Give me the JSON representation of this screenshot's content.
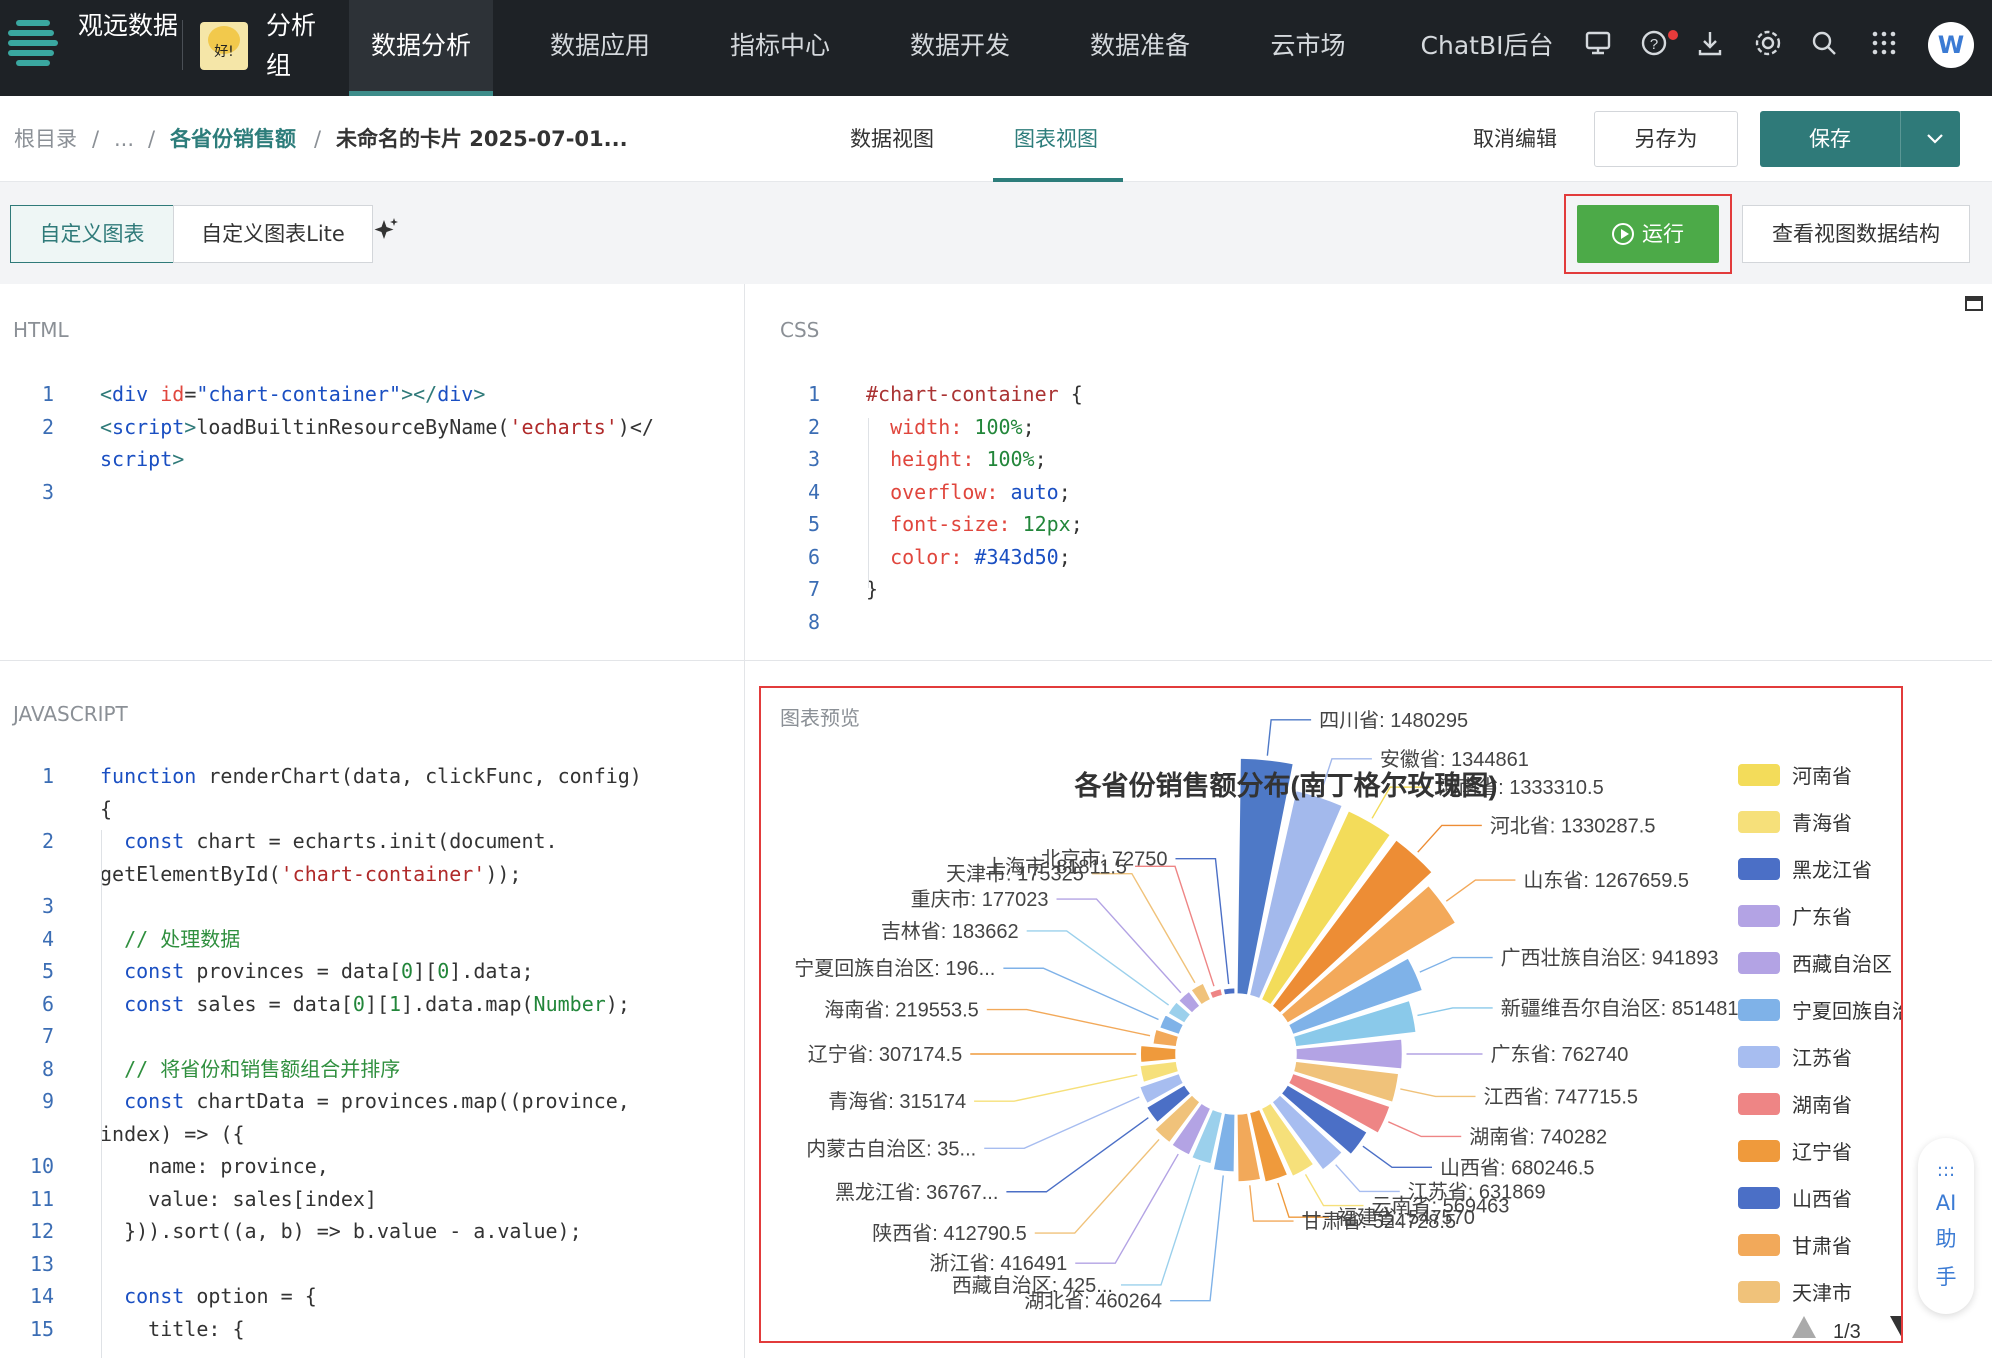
{
  "topnav": {
    "brand": "观远数据",
    "group": "分析组",
    "avatar_text": "好!",
    "items": [
      "数据分析",
      "数据应用",
      "指标中心",
      "数据开发",
      "数据准备",
      "云市场",
      "ChatBI后台"
    ],
    "user_initial": "W"
  },
  "breadcrumb": {
    "root": "根目录",
    "ellipsis": "...",
    "sep": "/",
    "folder": "各省份销售额",
    "current": "未命名的卡片 2025-07-01..."
  },
  "view_tabs": [
    "数据视图",
    "图表视图"
  ],
  "actions": {
    "cancel": "取消编辑",
    "save_as": "另存为",
    "save": "保存"
  },
  "mode_tabs": [
    "自定义图表",
    "自定义图表Lite"
  ],
  "run_label": "运行",
  "view_struct_label": "查看视图数据结构",
  "panels": {
    "html": "HTML",
    "css": "CSS",
    "js": "JAVASCRIPT",
    "preview": "图表预览"
  },
  "html_code": {
    "nums": [
      "1",
      "2",
      "",
      "3"
    ],
    "lines": [
      [
        [
          "p",
          "<"
        ],
        [
          "k",
          "div "
        ],
        [
          "a",
          "id"
        ],
        [
          "",
          "="
        ],
        [
          "v",
          "\"chart-container\""
        ],
        [
          "p",
          "></"
        ],
        [
          "k",
          "div"
        ],
        [
          "p",
          ">"
        ]
      ],
      [
        [
          "p",
          "<"
        ],
        [
          "k",
          "script"
        ],
        [
          "p",
          ">"
        ],
        [
          "",
          "loadBuiltinResourceByName("
        ],
        [
          "s",
          "'echarts'"
        ],
        [
          "",
          ")</"
        ]
      ],
      [
        [
          "k",
          "script"
        ],
        [
          "p",
          ">"
        ]
      ],
      []
    ]
  },
  "css_code": {
    "nums": [
      "1",
      "2",
      "3",
      "4",
      "5",
      "6",
      "7",
      "8"
    ],
    "lines": [
      [
        [
          "t",
          "#chart-container "
        ],
        [
          "",
          "{"
        ]
      ],
      [
        [
          "",
          "  "
        ],
        [
          "a",
          "width"
        ],
        [
          "a",
          ": "
        ],
        [
          "n",
          "100%"
        ],
        [
          "",
          ";"
        ]
      ],
      [
        [
          "",
          "  "
        ],
        [
          "a",
          "height"
        ],
        [
          "a",
          ": "
        ],
        [
          "n",
          "100%"
        ],
        [
          "",
          ";"
        ]
      ],
      [
        [
          "",
          "  "
        ],
        [
          "a",
          "overflow"
        ],
        [
          "a",
          ": "
        ],
        [
          "v",
          "auto"
        ],
        [
          "",
          ";"
        ]
      ],
      [
        [
          "",
          "  "
        ],
        [
          "a",
          "font-size"
        ],
        [
          "a",
          ": "
        ],
        [
          "n",
          "12px"
        ],
        [
          "",
          ";"
        ]
      ],
      [
        [
          "",
          "  "
        ],
        [
          "a",
          "color"
        ],
        [
          "a",
          ": "
        ],
        [
          "v",
          "#343d50"
        ],
        [
          "",
          ";"
        ]
      ],
      [
        [
          "",
          "}"
        ]
      ],
      []
    ]
  },
  "js_code": {
    "nums": [
      "1",
      "",
      "2",
      "",
      "3",
      "4",
      "5",
      "6",
      "7",
      "8",
      "9",
      "",
      "10",
      "11",
      "12",
      "13",
      "14",
      "15"
    ],
    "lines": [
      [
        [
          "k",
          "function "
        ],
        [
          "",
          "renderChart(data, clickFunc, config)"
        ]
      ],
      [
        [
          "",
          "{"
        ]
      ],
      [
        [
          "",
          "  "
        ],
        [
          "k",
          "const "
        ],
        [
          "",
          "chart = echarts.init(document."
        ]
      ],
      [
        [
          "",
          "getElementById("
        ],
        [
          "s",
          "'chart-container'"
        ],
        [
          "",
          "));"
        ]
      ],
      [],
      [
        [
          "",
          "  "
        ],
        [
          "c",
          "// 处理数据"
        ]
      ],
      [
        [
          "",
          "  "
        ],
        [
          "k",
          "const "
        ],
        [
          "",
          "provinces = data["
        ],
        [
          "n",
          "0"
        ],
        [
          "",
          "]["
        ],
        [
          "n",
          "0"
        ],
        [
          "",
          "].data;"
        ]
      ],
      [
        [
          "",
          "  "
        ],
        [
          "k",
          "const "
        ],
        [
          "",
          "sales = data["
        ],
        [
          "n",
          "0"
        ],
        [
          "",
          "]["
        ],
        [
          "n",
          "1"
        ],
        [
          "",
          "].data.map("
        ],
        [
          "n",
          "Number"
        ],
        [
          "",
          ");"
        ]
      ],
      [],
      [
        [
          "",
          "  "
        ],
        [
          "c",
          "// 将省份和销售额组合并排序"
        ]
      ],
      [
        [
          "",
          "  "
        ],
        [
          "k",
          "const "
        ],
        [
          "",
          "chartData = provinces.map((province,"
        ]
      ],
      [
        [
          "",
          "index) => ({"
        ]
      ],
      [
        [
          "",
          "    name: province,"
        ]
      ],
      [
        [
          "",
          "    value: sales[index]"
        ]
      ],
      [
        [
          "",
          "  })).sort((a, b) => b.value - a.value);"
        ]
      ],
      [],
      [
        [
          "",
          "  "
        ],
        [
          "k",
          "const "
        ],
        [
          "",
          "option = {"
        ]
      ],
      [
        [
          "",
          "    title: {"
        ]
      ]
    ]
  },
  "chart_data": {
    "type": "pie",
    "subtype": "rose",
    "title": "各省份销售额分布(南丁格尔玫瑰图)",
    "slices": [
      {
        "name": "四川省",
        "value": 1480295,
        "label": "四川省: 1480295",
        "color": "#4e79c7"
      },
      {
        "name": "安徽省",
        "value": 1344861,
        "label": "安徽省: 1344861",
        "color": "#a3b9ec"
      },
      {
        "name": "河南省",
        "value": 1333310.5,
        "label": "河南省: 1333310.5",
        "color": "#f3dc5a"
      },
      {
        "name": "河北省",
        "value": 1330287.5,
        "label": "河北省: 1330287.5",
        "color": "#ed8d35"
      },
      {
        "name": "山东省",
        "value": 1267659.5,
        "label": "山东省: 1267659.5",
        "color": "#f3a95a"
      },
      {
        "name": "广西壮族自治区",
        "value": 941893,
        "label": "广西壮族自治区: 941893",
        "color": "#7fb2e8"
      },
      {
        "name": "新疆维吾尔自治区",
        "value": 851481,
        "label": "新疆维吾尔自治区: 851481",
        "color": "#8ac9ea"
      },
      {
        "name": "广东省",
        "value": 762740,
        "label": "广东省: 762740",
        "color": "#b3a3e4"
      },
      {
        "name": "江西省",
        "value": 747715.5,
        "label": "江西省: 747715.5",
        "color": "#f0c27a"
      },
      {
        "name": "湖南省",
        "value": 740282,
        "label": "湖南省: 740282",
        "color": "#ee8585"
      },
      {
        "name": "山西省",
        "value": 680246.5,
        "label": "山西省: 680246.5",
        "color": "#4b6fc6"
      },
      {
        "name": "江苏省",
        "value": 631869,
        "label": "江苏省: 631869",
        "color": "#a7bdf0"
      },
      {
        "name": "云南省",
        "value": 569463,
        "label": "云南省: 569463",
        "color": "#f6e07a"
      },
      {
        "name": "福建省",
        "value": 547570,
        "label": "福建省: 547570",
        "color": "#ef9a3c"
      },
      {
        "name": "甘肃省",
        "value": 524728.5,
        "label": "甘肃省: 524728.5",
        "color": "#f2a95a"
      },
      {
        "name": "湖北省",
        "value": 460264,
        "label": "湖北省: 460264",
        "color": "#7fb2e8"
      },
      {
        "name": "西藏自治区",
        "value": 425000,
        "label": "西藏自治区: 425...",
        "color": "#9bd0ec"
      },
      {
        "name": "浙江省",
        "value": 416491,
        "label": "浙江省: 416491",
        "color": "#b3a3e4"
      },
      {
        "name": "陕西省",
        "value": 412790.5,
        "label": "陕西省: 412790.5",
        "color": "#f0c27a"
      },
      {
        "name": "黑龙江省",
        "value": 367670,
        "label": "黑龙江省: 36767...",
        "color": "#4b6fc6"
      },
      {
        "name": "内蒙古自治区",
        "value": 350000,
        "label": "内蒙古自治区: 35...",
        "color": "#a7bdf0"
      },
      {
        "name": "青海省",
        "value": 315174,
        "label": "青海省: 315174",
        "color": "#f6e07a"
      },
      {
        "name": "辽宁省",
        "value": 307174.5,
        "label": "辽宁省: 307174.5",
        "color": "#ef9a3c"
      },
      {
        "name": "海南省",
        "value": 219553.5,
        "label": "海南省: 219553.5",
        "color": "#f2a95a"
      },
      {
        "name": "宁夏回族自治区",
        "value": 196000,
        "label": "宁夏回族自治区: 196...",
        "color": "#7fb2e8"
      },
      {
        "name": "吉林省",
        "value": 183662,
        "label": "吉林省: 183662",
        "color": "#9bd0ec"
      },
      {
        "name": "重庆市",
        "value": 177023,
        "label": "重庆市: 177023",
        "color": "#b3a3e4"
      },
      {
        "name": "天津市",
        "value": 175325,
        "label": "天津市: 175325",
        "color": "#f0c27a"
      },
      {
        "name": "上海市",
        "value": 81811.5,
        "label": "上海市: 81811.5",
        "color": "#ee8585"
      },
      {
        "name": "北京市",
        "value": 72750,
        "label": "北京市: 72750",
        "color": "#4b6fc6"
      }
    ],
    "legend": [
      {
        "name": "河南省",
        "color": "#f3dc5a"
      },
      {
        "name": "青海省",
        "color": "#f6e07a"
      },
      {
        "name": "黑龙江省",
        "color": "#4b6fc6"
      },
      {
        "name": "广东省",
        "color": "#b3a3e4"
      },
      {
        "name": "西藏自治区",
        "color": "#b3a3e4"
      },
      {
        "name": "宁夏回族自治区",
        "color": "#7fb2e8"
      },
      {
        "name": "江苏省",
        "color": "#a7bdf0"
      },
      {
        "name": "湖南省",
        "color": "#ee8585"
      },
      {
        "name": "辽宁省",
        "color": "#ef9a3c"
      },
      {
        "name": "山西省",
        "color": "#4b6fc6"
      },
      {
        "name": "甘肃省",
        "color": "#f2a95a"
      },
      {
        "name": "天津市",
        "color": "#f0c27a"
      }
    ],
    "legend_position": "right",
    "legend_page": "1/3"
  },
  "assistant": {
    "dots": ":::",
    "label1": "AI",
    "label2": "助",
    "label3": "手"
  }
}
